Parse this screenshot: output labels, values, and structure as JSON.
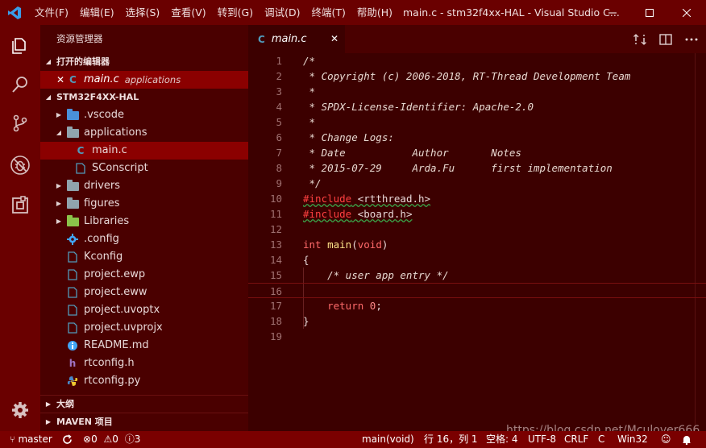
{
  "window": {
    "title": "main.c - stm32f4xx-HAL - Visual Studio C..."
  },
  "menu": [
    "文件(F)",
    "编辑(E)",
    "选择(S)",
    "查看(V)",
    "转到(G)",
    "调试(D)",
    "终端(T)",
    "帮助(H)"
  ],
  "sidebar": {
    "title": "资源管理器",
    "open_editors_label": "打开的编辑器",
    "open_editor": {
      "close": "✕",
      "icon": "C",
      "name": "main.c",
      "folder": "applications"
    },
    "project_label": "STM32F4XX-HAL",
    "tree": [
      {
        "label": ".vscode",
        "twisty": "▶"
      },
      {
        "label": "applications",
        "twisty": "◢"
      },
      {
        "label": "main.c",
        "icon": "C"
      },
      {
        "label": "SConscript"
      },
      {
        "label": "drivers",
        "twisty": "▶"
      },
      {
        "label": "figures",
        "twisty": "▶"
      },
      {
        "label": "Libraries",
        "twisty": "▶"
      },
      {
        "label": ".config"
      },
      {
        "label": "Kconfig"
      },
      {
        "label": "project.ewp"
      },
      {
        "label": "project.eww"
      },
      {
        "label": "project.uvoptx"
      },
      {
        "label": "project.uvprojx"
      },
      {
        "label": "README.md"
      },
      {
        "label": "rtconfig.h",
        "icon": "h"
      },
      {
        "label": "rtconfig.py"
      }
    ],
    "outline_label": "大纲",
    "maven_label": "MAVEN 项目"
  },
  "editor": {
    "tab": {
      "icon": "C",
      "name": "main.c",
      "close": "✕"
    },
    "line_numbers": [
      "1",
      "2",
      "3",
      "4",
      "5",
      "6",
      "7",
      "8",
      "9",
      "10",
      "11",
      "12",
      "13",
      "14",
      "15",
      "16",
      "17",
      "18",
      "19"
    ],
    "lines": {
      "l1": "/*",
      "l2": " * Copyright (c) 2006-2018, RT-Thread Development Team",
      "l3": " *",
      "l4": " * SPDX-License-Identifier: Apache-2.0",
      "l5": " *",
      "l6": " * Change Logs:",
      "l7": " * Date           Author       Notes",
      "l8": " * 2015-07-29     Arda.Fu      first implementation",
      "l9": " */",
      "l10_pre": "#include",
      "l10_rest": " <rtthread.h>",
      "l11_pre": "#include",
      "l11_rest": " <board.h>",
      "l13_kw": "int",
      "l13_fn": "main",
      "l13_open": "(",
      "l13_void": "void",
      "l13_close": ")",
      "l14": "{",
      "l15": "    /* user app entry */",
      "l17_kw": "return",
      "l17_num": "0",
      "l17_end": ";",
      "l18": "}"
    },
    "watermark": "https://blog.csdn.net/Mculover666"
  },
  "statusbar": {
    "branch": "master",
    "errors": "0",
    "warnings": "0",
    "infos": "3",
    "function": "main(void)",
    "position": "行 16，列 1",
    "spaces": "空格: 4",
    "encoding": "UTF-8",
    "eol": "CRLF",
    "language": "C",
    "platform": "Win32"
  },
  "colors": {
    "titlebar": "#6a0000",
    "sidebar": "#4a0000",
    "editor": "#3c0000",
    "selection": "#8b0000",
    "statusbar": "#7a0000"
  }
}
